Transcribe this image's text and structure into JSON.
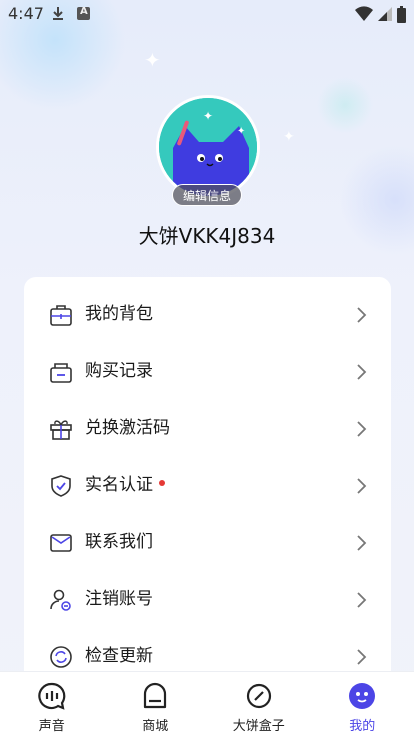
{
  "status_bar": {
    "time": "4:47"
  },
  "profile": {
    "edit_label": "编辑信息",
    "username": "大饼VKK4J834"
  },
  "menu": [
    {
      "label": "我的背包",
      "icon": "backpack-icon"
    },
    {
      "label": "购买记录",
      "icon": "purchase-record-icon"
    },
    {
      "label": "兑换激活码",
      "icon": "gift-icon"
    },
    {
      "label": "实名认证",
      "icon": "shield-check-icon",
      "badge": "red-dot"
    },
    {
      "label": "联系我们",
      "icon": "mail-icon"
    },
    {
      "label": "注销账号",
      "icon": "user-cancel-icon"
    },
    {
      "label": "检查更新",
      "icon": "refresh-icon"
    }
  ],
  "bottom_nav": [
    {
      "label": "声音",
      "icon": "chat-bubble-icon"
    },
    {
      "label": "商城",
      "icon": "store-icon"
    },
    {
      "label": "大饼盒子",
      "icon": "link-icon"
    },
    {
      "label": "我的",
      "icon": "mascot-face-icon",
      "active": true
    }
  ],
  "colors": {
    "accent": "#4c45e6",
    "avatar_bg": "#35c9bd",
    "dot": "#e53935"
  }
}
